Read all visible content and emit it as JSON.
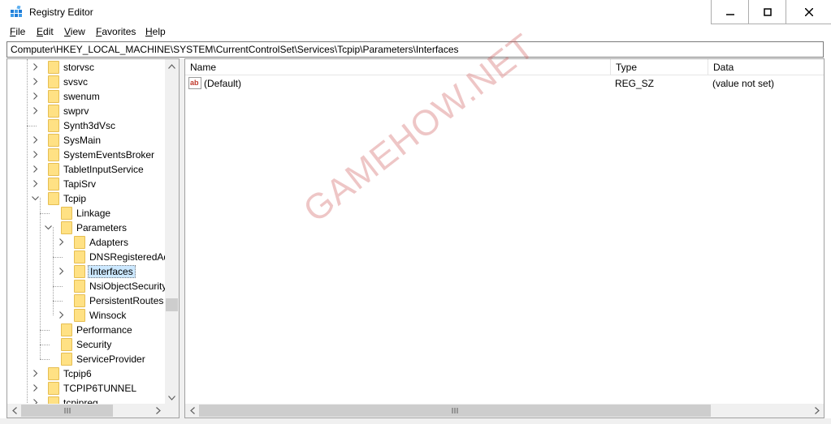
{
  "window": {
    "title": "Registry Editor",
    "icon": "registry-icon"
  },
  "menu": [
    {
      "label": "File",
      "accel": "F",
      "rest": "ile"
    },
    {
      "label": "Edit",
      "accel": "E",
      "rest": "dit"
    },
    {
      "label": "View",
      "accel": "V",
      "rest": "iew"
    },
    {
      "label": "Favorites",
      "accel": "F",
      "rest": "avorites"
    },
    {
      "label": "Help",
      "accel": "H",
      "rest": "elp"
    }
  ],
  "address": "Computer\\HKEY_LOCAL_MACHINE\\SYSTEM\\CurrentControlSet\\Services\\Tcpip\\Parameters\\Interfaces",
  "tree": [
    {
      "label": "storvsc",
      "level": 1,
      "expander": "collapsed"
    },
    {
      "label": "svsvc",
      "level": 1,
      "expander": "collapsed"
    },
    {
      "label": "swenum",
      "level": 1,
      "expander": "collapsed"
    },
    {
      "label": "swprv",
      "level": 1,
      "expander": "collapsed"
    },
    {
      "label": "Synth3dVsc",
      "level": 1,
      "expander": "none"
    },
    {
      "label": "SysMain",
      "level": 1,
      "expander": "collapsed"
    },
    {
      "label": "SystemEventsBroker",
      "level": 1,
      "expander": "collapsed"
    },
    {
      "label": "TabletInputService",
      "level": 1,
      "expander": "collapsed"
    },
    {
      "label": "TapiSrv",
      "level": 1,
      "expander": "collapsed"
    },
    {
      "label": "Tcpip",
      "level": 1,
      "expander": "expanded"
    },
    {
      "label": "Linkage",
      "level": 2,
      "expander": "none"
    },
    {
      "label": "Parameters",
      "level": 2,
      "expander": "expanded"
    },
    {
      "label": "Adapters",
      "level": 3,
      "expander": "collapsed"
    },
    {
      "label": "DNSRegisteredAd",
      "level": 3,
      "expander": "none"
    },
    {
      "label": "Interfaces",
      "level": 3,
      "expander": "collapsed",
      "selected": true
    },
    {
      "label": "NsiObjectSecurity",
      "level": 3,
      "expander": "none"
    },
    {
      "label": "PersistentRoutes",
      "level": 3,
      "expander": "none"
    },
    {
      "label": "Winsock",
      "level": 3,
      "expander": "collapsed"
    },
    {
      "label": "Performance",
      "level": 2,
      "expander": "none"
    },
    {
      "label": "Security",
      "level": 2,
      "expander": "none"
    },
    {
      "label": "ServiceProvider",
      "level": 2,
      "expander": "none"
    },
    {
      "label": "Tcpip6",
      "level": 1,
      "expander": "collapsed"
    },
    {
      "label": "TCPIP6TUNNEL",
      "level": 1,
      "expander": "collapsed"
    },
    {
      "label": "tcpipreg",
      "level": 1,
      "expander": "collapsed"
    }
  ],
  "list": {
    "columns": [
      "Name",
      "Type",
      "Data"
    ],
    "rows": [
      {
        "name": "(Default)",
        "type": "REG_SZ",
        "data": "(value not set)",
        "icon": "reg-sz-icon"
      }
    ]
  },
  "watermark": "GAMEHOW.NET",
  "colors": {
    "selection": "#cce8ff",
    "folder": "#ffe184",
    "watermark": "#cd5c5c"
  }
}
